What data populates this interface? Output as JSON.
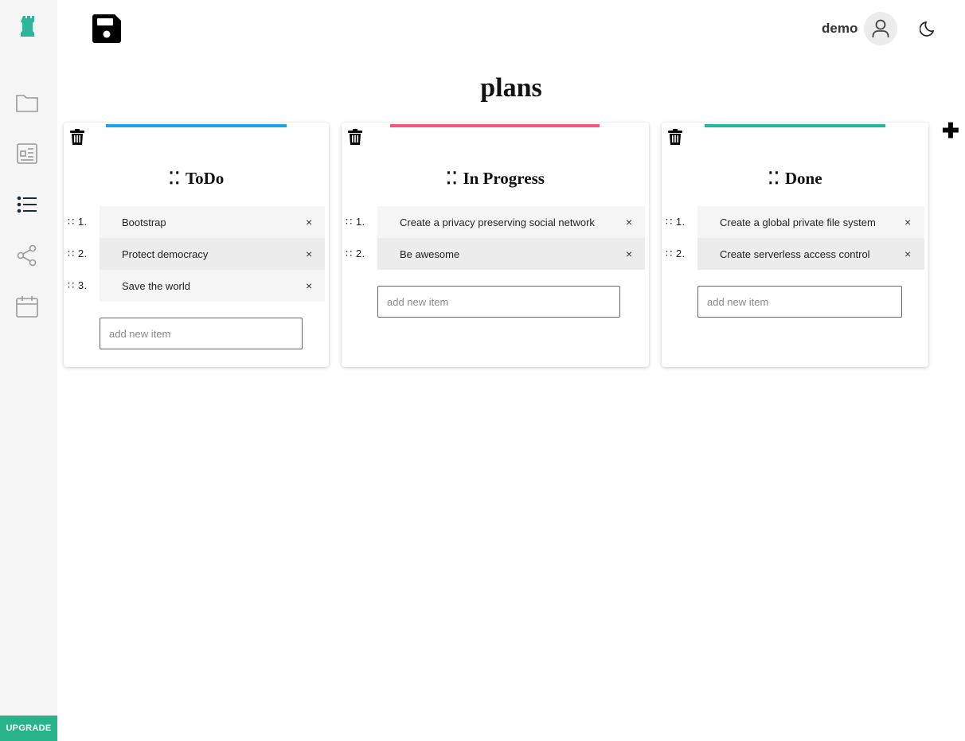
{
  "sidebar": {
    "logo_icon": "tower-logo-icon",
    "items": [
      {
        "icon": "folder-icon"
      },
      {
        "icon": "document-icon"
      },
      {
        "icon": "list-icon",
        "active": true
      },
      {
        "icon": "share-icon"
      },
      {
        "icon": "calendar-icon"
      }
    ],
    "upgrade_label": "UPGRADE"
  },
  "header": {
    "save_icon": "save-icon",
    "username": "demo",
    "avatar_icon": "user-icon",
    "theme_icon": "moon-icon"
  },
  "page": {
    "title": "plans",
    "add_column_label": "✚"
  },
  "columns": [
    {
      "title": "ToDo",
      "grip": "⁚⁚",
      "accent": "#1aa3e8",
      "items": [
        {
          "num": "∷ 1.",
          "text": "Bootstrap"
        },
        {
          "num": "∷ 2.",
          "text": "Protect democracy"
        },
        {
          "num": "∷ 3.",
          "text": "Save the world"
        }
      ],
      "placeholder": "add new item"
    },
    {
      "title": "In Progress",
      "grip": "⁚⁚",
      "accent": "#f0587f",
      "items": [
        {
          "num": "∷ 1.",
          "text": "Create a privacy preserving social network"
        },
        {
          "num": "∷ 2.",
          "text": "Be awesome"
        }
      ],
      "placeholder": "add new item"
    },
    {
      "title": "Done",
      "grip": "⁚⁚",
      "accent": "#1fb89a",
      "items": [
        {
          "num": "∷ 1.",
          "text": "Create a global private file system"
        },
        {
          "num": "∷ 2.",
          "text": "Create serverless access control"
        }
      ],
      "placeholder": "add new item"
    }
  ],
  "remove_label": "×"
}
